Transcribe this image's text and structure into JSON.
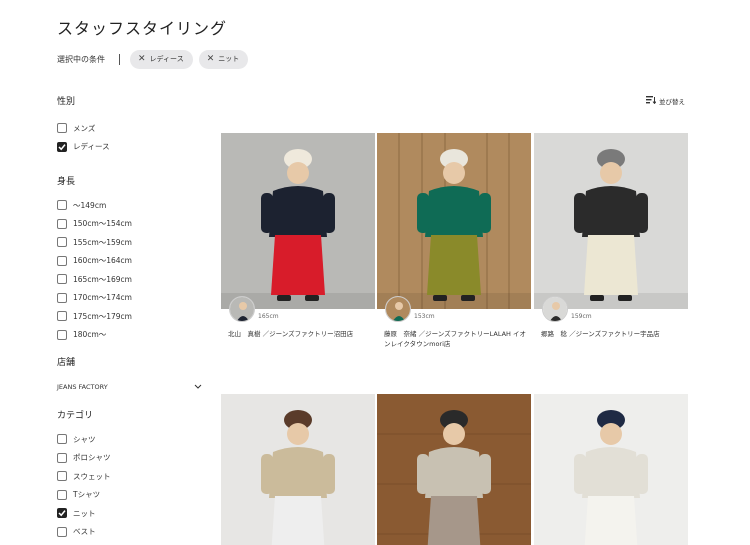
{
  "page": {
    "title": "スタッフスタイリング"
  },
  "conditions": {
    "label": "選択中の条件",
    "chips": [
      {
        "label": "レディース"
      },
      {
        "label": "ニット"
      }
    ]
  },
  "sort": {
    "label": "並び替え",
    "icon": "sort-icon"
  },
  "sidebar": {
    "gender": {
      "title": "性別",
      "options": [
        {
          "label": "メンズ",
          "checked": false
        },
        {
          "label": "レディース",
          "checked": true
        }
      ]
    },
    "height": {
      "title": "身長",
      "options": [
        {
          "label": "～149cm",
          "checked": false
        },
        {
          "label": "150cm～154cm",
          "checked": false
        },
        {
          "label": "155cm～159cm",
          "checked": false
        },
        {
          "label": "160cm～164cm",
          "checked": false
        },
        {
          "label": "165cm～169cm",
          "checked": false
        },
        {
          "label": "170cm～174cm",
          "checked": false
        },
        {
          "label": "175cm～179cm",
          "checked": false
        },
        {
          "label": "180cm～",
          "checked": false
        }
      ]
    },
    "store": {
      "title": "店舗",
      "value": "JEANS FACTORY"
    },
    "category": {
      "title": "カテゴリ",
      "options": [
        {
          "label": "シャツ",
          "checked": false
        },
        {
          "label": "ポロシャツ",
          "checked": false
        },
        {
          "label": "スウェット",
          "checked": false
        },
        {
          "label": "Tシャツ",
          "checked": false
        },
        {
          "label": "ニット",
          "checked": true
        },
        {
          "label": "ベスト",
          "checked": false
        }
      ]
    }
  },
  "cards": [
    {
      "height": "165cm",
      "staff": "北山　真樹 ／ジーンズファクトリー沼田店",
      "bg": "#b9b9b6",
      "top": "#1c2230",
      "bottom": "#d81c2a",
      "hat": "#efe9dc"
    },
    {
      "height": "153cm",
      "staff": "藤原　奈緒 ／ジーンズファクトリーLALAH イオンレイクタウンmori店",
      "bg": "#b08a5e",
      "top": "#0f6b55",
      "bottom": "#8a8a2a",
      "hat": "#e9e6dc"
    },
    {
      "height": "159cm",
      "staff": "郷路　稔 ／ジーンズファクトリー宇品店",
      "bg": "#d9d9d7",
      "top": "#2b2b2b",
      "bottom": "#ece7d3",
      "hat": "#7a7a7a"
    },
    {
      "height": "",
      "staff": "",
      "bg": "#e7e6e4",
      "top": "#cbbb9b",
      "bottom": "#eeeeee",
      "hat": "#5a3b2a"
    },
    {
      "height": "",
      "staff": "",
      "bg": "#8a5a32",
      "top": "#c8c1b2",
      "bottom": "#a6978a",
      "hat": "#2a2a2a"
    },
    {
      "height": "",
      "staff": "",
      "bg": "#eeeeec",
      "top": "#e2dfd6",
      "bottom": "#f4f3ee",
      "hat": "#1f2a44"
    }
  ]
}
